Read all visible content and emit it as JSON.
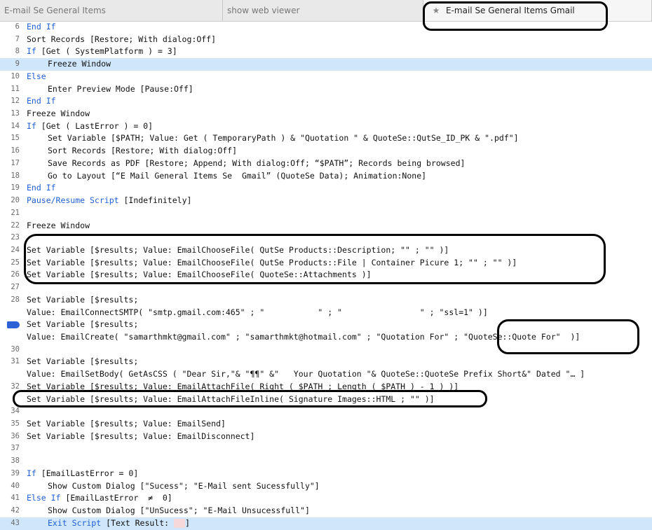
{
  "tabs": [
    {
      "label": "E-mail Se General Items"
    },
    {
      "label": "show web viewer"
    },
    {
      "label": "E-mail Se General Items Gmail",
      "icon": "star-icon"
    }
  ],
  "lines": [
    {
      "n": "6",
      "segs": [
        {
          "t": "End If",
          "k": 1
        }
      ]
    },
    {
      "n": "7",
      "segs": [
        {
          "t": "Sort Records [Restore; With dialog:Off]"
        }
      ]
    },
    {
      "n": "8",
      "segs": [
        {
          "t": "If",
          "k": 1
        },
        {
          "t": " [Get ( SystemPlatform ) = 3]"
        }
      ]
    },
    {
      "n": "9",
      "hl": true,
      "indent": true,
      "segs": [
        {
          "t": "Freeze Window"
        }
      ]
    },
    {
      "n": "10",
      "segs": [
        {
          "t": "Else",
          "k": 1
        }
      ]
    },
    {
      "n": "11",
      "indent": true,
      "segs": [
        {
          "t": "Enter Preview Mode [Pause:Off]"
        }
      ]
    },
    {
      "n": "12",
      "segs": [
        {
          "t": "End If",
          "k": 1
        }
      ]
    },
    {
      "n": "13",
      "segs": [
        {
          "t": "Freeze Window"
        }
      ]
    },
    {
      "n": "14",
      "segs": [
        {
          "t": "If",
          "k": 1
        },
        {
          "t": " [Get ( LastError ) = 0]"
        }
      ]
    },
    {
      "n": "15",
      "indent": true,
      "segs": [
        {
          "t": "Set Variable [$PATH; Value: Get ( TemporaryPath ) & \"Quotation \" & QuoteSe::QutSe_ID_PK & \".pdf\"]"
        }
      ]
    },
    {
      "n": "16",
      "indent": true,
      "segs": [
        {
          "t": "Sort Records [Restore; With dialog:Off]"
        }
      ]
    },
    {
      "n": "17",
      "indent": true,
      "segs": [
        {
          "t": "Save Records as PDF [Restore; Append; With dialog:Off; “$PATH”; Records being browsed]"
        }
      ]
    },
    {
      "n": "18",
      "indent": true,
      "segs": [
        {
          "t": "Go to Layout [“E Mail General Items Se  Gmail” (QuoteSe Data); Animation:None]"
        }
      ]
    },
    {
      "n": "19",
      "segs": [
        {
          "t": "End If",
          "k": 1
        }
      ]
    },
    {
      "n": "20",
      "segs": [
        {
          "t": "Pause/Resume Script",
          "k": 1
        },
        {
          "t": " [Indefinitely]"
        }
      ]
    },
    {
      "n": "21",
      "segs": []
    },
    {
      "n": "22",
      "segs": [
        {
          "t": "Freeze Window"
        }
      ]
    },
    {
      "n": "23",
      "segs": []
    },
    {
      "n": "24",
      "segs": [
        {
          "t": "Set Variable [$results; Value: EmailChooseFile( QutSe Products::Description; \"\" ; \"\" )]"
        }
      ]
    },
    {
      "n": "25",
      "segs": [
        {
          "t": "Set Variable [$results; Value: EmailChooseFile( QutSe Products::File | Container Picure 1; \"\" ; \"\" )]"
        }
      ]
    },
    {
      "n": "26",
      "segs": [
        {
          "t": "Set Variable [$results; Value: EmailChooseFile( QuoteSe::Attachments )]"
        }
      ]
    },
    {
      "n": "27",
      "segs": []
    },
    {
      "n": "28",
      "segs": [
        {
          "t": "Set Variable [$results;"
        }
      ]
    },
    {
      "n": "",
      "segs": [
        {
          "t": "Value: EmailConnectSMTP( \"smtp.gmail.com:465\" ; \"           \" ; \"                \" ; \"ssl=1\" )]"
        }
      ]
    },
    {
      "n": "",
      "bp": true,
      "segs": [
        {
          "t": "Set Variable [$results;"
        }
      ]
    },
    {
      "n": "",
      "segs": [
        {
          "t": "Value: EmailCreate( \"samarthmkt@gmail.com\" ; \"samarthmkt@hotmail.com\" ; \"Quotation For\" ; \"QuoteSe::Quote For\"  )]"
        }
      ]
    },
    {
      "n": "30",
      "segs": []
    },
    {
      "n": "31",
      "segs": [
        {
          "t": "Set Variable [$results;"
        }
      ]
    },
    {
      "n": "",
      "segs": [
        {
          "t": "Value: EmailSetBody( GetAsCSS ( \"Dear Sir,\"& \"¶¶\" &\"   Your Quotation \"& QuoteSe::QuoteSe Prefix Short&\" Dated \"… ]"
        }
      ]
    },
    {
      "n": "32",
      "segs": [
        {
          "t": "Set Variable [$results; Value: EmailAttachFile( Right ( $PATH ; Length ( $PATH ) - 1 ) )]"
        }
      ]
    },
    {
      "n": "",
      "segs": [
        {
          "t": "Set Variable [$results; Value: EmailAttachFileInline( Signature Images::HTML ; \"\" )]"
        }
      ]
    },
    {
      "n": "34",
      "segs": []
    },
    {
      "n": "35",
      "segs": [
        {
          "t": "Set Variable [$results; Value: EmailSend]"
        }
      ]
    },
    {
      "n": "36",
      "segs": [
        {
          "t": "Set Variable [$results; Value: EmailDisconnect]"
        }
      ]
    },
    {
      "n": "37",
      "segs": []
    },
    {
      "n": "38",
      "segs": []
    },
    {
      "n": "39",
      "segs": [
        {
          "t": "If",
          "k": 1
        },
        {
          "t": " [EmailLastError = 0]"
        }
      ]
    },
    {
      "n": "40",
      "indent": true,
      "segs": [
        {
          "t": "Show Custom Dialog [\"Sucess\"; \"E-Mail sent Sucessfully\"]"
        }
      ]
    },
    {
      "n": "41",
      "segs": [
        {
          "t": "Else If",
          "k": 1
        },
        {
          "t": " [EmailLastError  ≠  0]"
        }
      ]
    },
    {
      "n": "42",
      "indent": true,
      "segs": [
        {
          "t": "Show Custom Dialog [\"UnSucess\"; \"E-Mail Unsucessfull\"]"
        }
      ]
    },
    {
      "n": "43",
      "hl": true,
      "indent": true,
      "pink": true,
      "segs": [
        {
          "t": "Exit Script",
          "k": 1
        },
        {
          "t": " [Text Result: "
        },
        {
          "t": "]",
          "pinkBefore": true
        }
      ]
    }
  ],
  "colors": {
    "keyword": "#1f5fd6",
    "highlight": "#cfe6fb",
    "breakpoint": "#2b62d6"
  }
}
